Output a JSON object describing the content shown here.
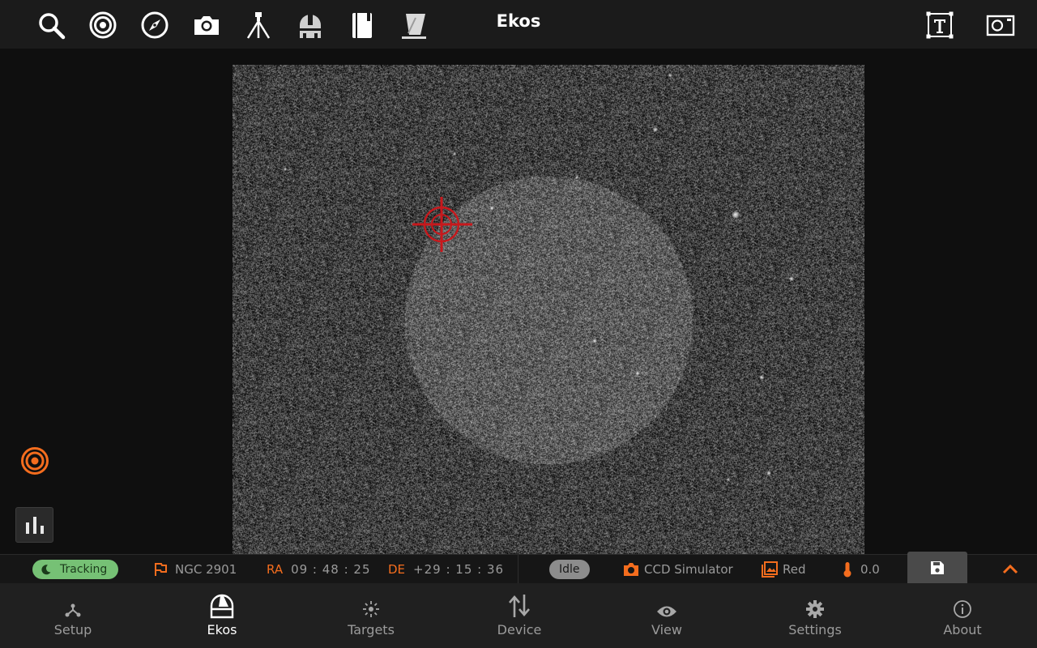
{
  "window": {
    "title": "Ekos"
  },
  "toolbar": {
    "icons": [
      "search-icon",
      "target-icon",
      "compass-icon",
      "camera-icon",
      "tripod-icon",
      "observatory-dome-icon",
      "notebook-icon",
      "flat-panel-icon"
    ],
    "right_icons": [
      "text-frame-icon",
      "capture-frame-icon"
    ]
  },
  "viewer": {
    "image": "fits-star-field",
    "crosshair_color": "#c8181c"
  },
  "side": {
    "target_icon": "bullseye-icon",
    "stats_icon": "bar-chart-icon",
    "accent": "#f46d1e"
  },
  "status": {
    "tracking_label": "Tracking",
    "target_name": "NGC 2901",
    "ra_label": "RA",
    "ra_value": "09 : 48 : 25",
    "de_label": "DE",
    "de_value": "+29 : 15 : 36",
    "state_label": "Idle",
    "camera_name": "CCD Simulator",
    "filter_name": "Red",
    "temperature": "0.0"
  },
  "nav": {
    "items": [
      {
        "label": "Setup",
        "icon": "setup-icon"
      },
      {
        "label": "Ekos",
        "icon": "ekos-dome-icon"
      },
      {
        "label": "Targets",
        "icon": "targets-icon"
      },
      {
        "label": "Device",
        "icon": "device-arrows-icon"
      },
      {
        "label": "View",
        "icon": "eye-icon"
      },
      {
        "label": "Settings",
        "icon": "gear-icon"
      },
      {
        "label": "About",
        "icon": "info-icon"
      }
    ],
    "active": "Ekos"
  }
}
